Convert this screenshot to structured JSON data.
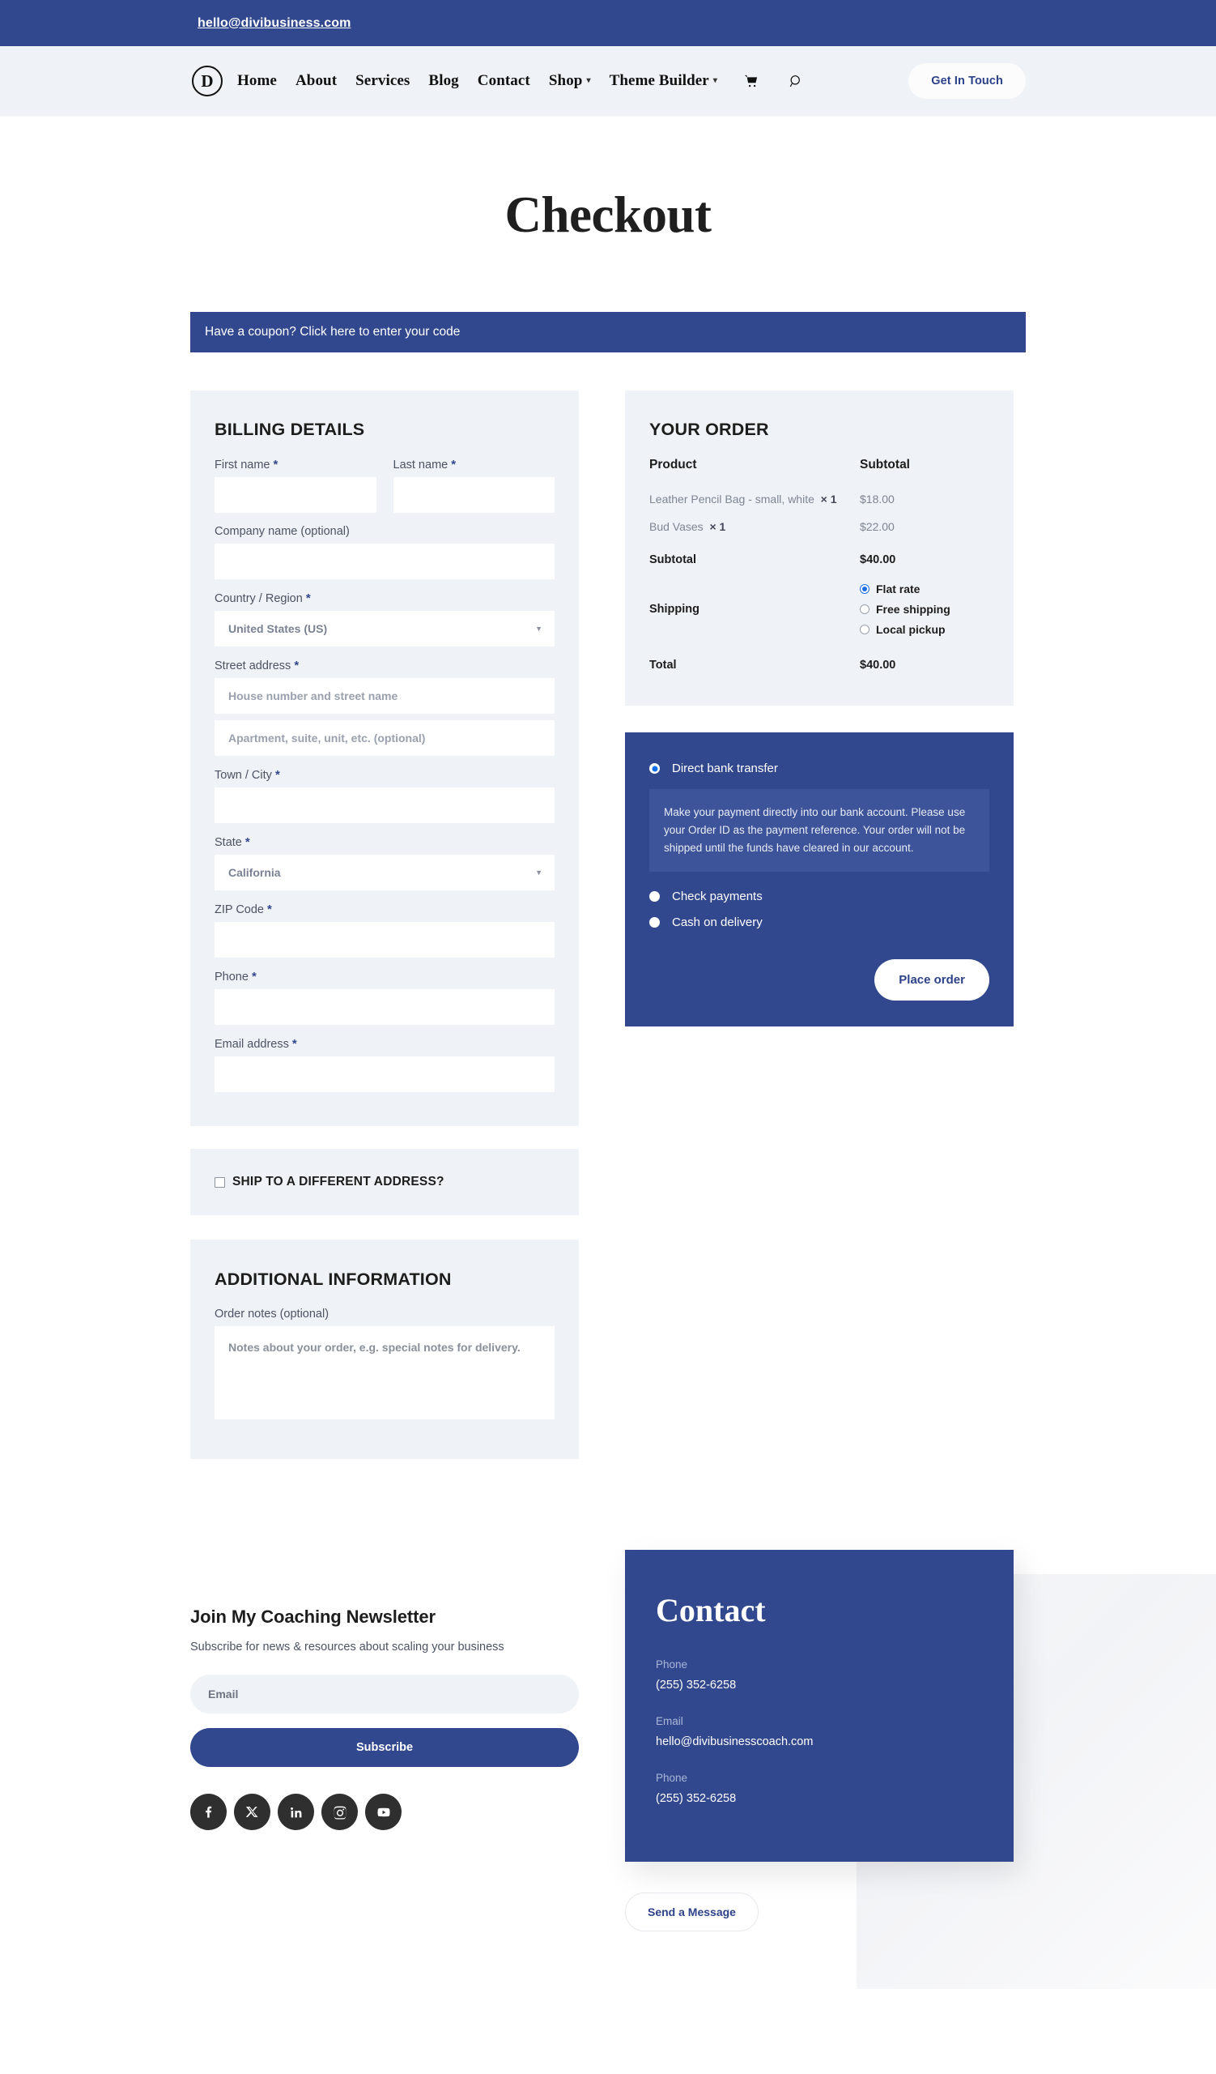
{
  "topbar": {
    "email": "hello@divibusiness.com"
  },
  "nav": {
    "logo_letter": "D",
    "items": [
      {
        "label": "Home",
        "has_submenu": false
      },
      {
        "label": "About",
        "has_submenu": false
      },
      {
        "label": "Services",
        "has_submenu": false
      },
      {
        "label": "Blog",
        "has_submenu": false
      },
      {
        "label": "Contact",
        "has_submenu": false
      },
      {
        "label": "Shop",
        "has_submenu": true
      },
      {
        "label": "Theme Builder",
        "has_submenu": true
      }
    ],
    "cart_icon": "cart-icon",
    "search_icon": "search-icon",
    "cta_label": "Get In Touch"
  },
  "page": {
    "title": "Checkout",
    "coupon_bar": "Have a coupon? Click here to enter your code"
  },
  "billing": {
    "heading": "BILLING DETAILS",
    "first_name_label": "First name",
    "last_name_label": "Last name",
    "company_label": "Company name (optional)",
    "country_label": "Country / Region",
    "country_value": "United States (US)",
    "street_label": "Street address",
    "street_placeholder": "House number and street name",
    "street2_placeholder": "Apartment, suite, unit, etc. (optional)",
    "city_label": "Town / City",
    "state_label": "State",
    "state_value": "California",
    "zip_label": "ZIP Code",
    "phone_label": "Phone",
    "email_label": "Email address",
    "required_mark": "*"
  },
  "shipping_toggle": {
    "label": "SHIP TO A DIFFERENT ADDRESS?",
    "checked": false
  },
  "additional": {
    "heading": "ADDITIONAL INFORMATION",
    "notes_label": "Order notes (optional)",
    "notes_placeholder": "Notes about your order, e.g. special notes for delivery."
  },
  "order": {
    "heading": "YOUR ORDER",
    "col_product": "Product",
    "col_subtotal": "Subtotal",
    "items": [
      {
        "name": "Leather Pencil Bag - small, white",
        "qty": "× 1",
        "price": "$18.00"
      },
      {
        "name": "Bud Vases",
        "qty": "× 1",
        "price": "$22.00"
      }
    ],
    "subtotal_label": "Subtotal",
    "subtotal_value": "$40.00",
    "shipping_label": "Shipping",
    "shipping_options": [
      {
        "label": "Flat rate",
        "selected": true
      },
      {
        "label": "Free shipping",
        "selected": false
      },
      {
        "label": "Local pickup",
        "selected": false
      }
    ],
    "total_label": "Total",
    "total_value": "$40.00"
  },
  "payment": {
    "options": [
      {
        "label": "Direct bank transfer",
        "selected": true
      },
      {
        "label": "Check payments",
        "selected": false
      },
      {
        "label": "Cash on delivery",
        "selected": false
      }
    ],
    "description": "Make your payment directly into our bank account. Please use your Order ID as the payment reference. Your order will not be shipped until the funds have cleared in our account.",
    "place_order_label": "Place order"
  },
  "footer": {
    "newsletter": {
      "title": "Join My Coaching Newsletter",
      "subtitle": "Subscribe for news & resources about scaling your business",
      "email_placeholder": "Email",
      "button_label": "Subscribe"
    },
    "socials": [
      {
        "name": "facebook-icon"
      },
      {
        "name": "x-twitter-icon"
      },
      {
        "name": "linkedin-icon"
      },
      {
        "name": "instagram-icon"
      },
      {
        "name": "youtube-icon"
      }
    ],
    "contact": {
      "title": "Contact",
      "phone_label_1": "Phone",
      "phone_value_1": "(255) 352-6258",
      "email_label": "Email",
      "email_value": "hello@divibusinesscoach.com",
      "phone_label_2": "Phone",
      "phone_value_2": "(255) 352-6258"
    },
    "send_message_label": "Send a Message"
  },
  "colors": {
    "navy": "#32488e",
    "panel": "#eff2f6",
    "nav_bg": "#eff2f6",
    "accent_radio": "#1d6fe0",
    "social_bg": "#2f2f2f"
  }
}
